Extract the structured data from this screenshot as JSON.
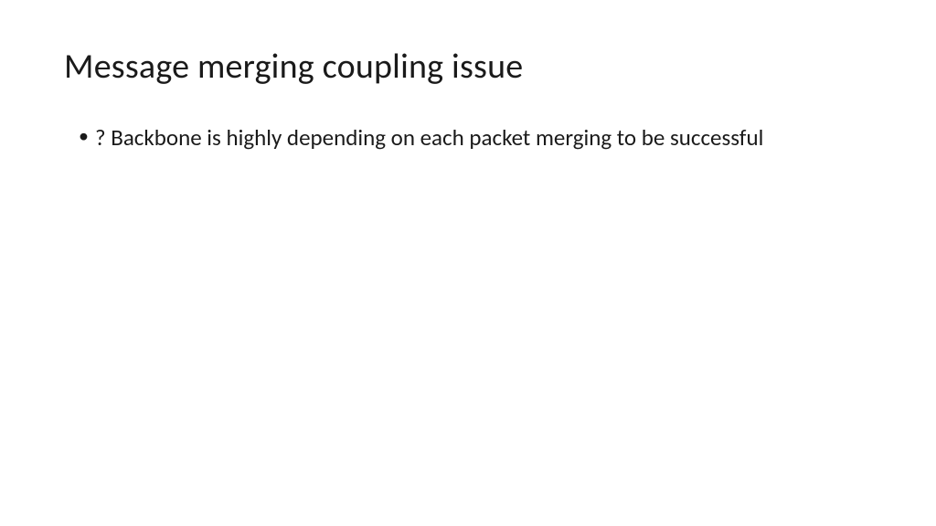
{
  "slide": {
    "title": "Message merging coupling issue",
    "bullets": [
      {
        "marker": "•",
        "text": "? Backbone is highly depending on each packet merging to be successful"
      }
    ]
  }
}
